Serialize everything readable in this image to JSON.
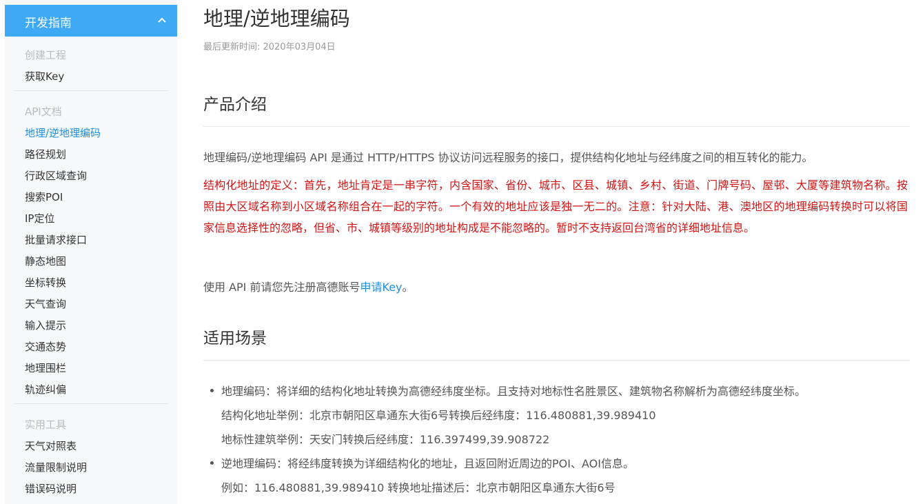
{
  "sidebar": {
    "header": "开发指南",
    "groups": [
      {
        "title": "创建工程",
        "items": [
          "获取Key"
        ]
      },
      {
        "title": "API文档",
        "items": [
          "地理/逆地理编码",
          "路径规划",
          "行政区域查询",
          "搜索POI",
          "IP定位",
          "批量请求接口",
          "静态地图",
          "坐标转换",
          "天气查询",
          "输入提示",
          "交通态势",
          "地理围栏",
          "轨迹纠偏"
        ]
      },
      {
        "title": "实用工具",
        "items": [
          "天气对照表",
          "流量限制说明",
          "错误码说明"
        ]
      }
    ]
  },
  "main": {
    "title": "地理/逆地理编码",
    "updated": "最后更新时间: 2020年03月04日",
    "sections": [
      {
        "heading": "产品介绍",
        "intro": "地理编码/逆地理编码 API 是通过 HTTP/HTTPS 协议访问远程服务的接口，提供结构化地址与经纬度之间的相互转化的能力。",
        "notice": "结构化地址的定义：首先，地址肯定是一串字符，内含国家、省份、城市、区县、城镇、乡村、街道、门牌号码、屋邨、大厦等建筑物名称。按照由大区域名称到小区域名称组合在一起的字符。一个有效的地址应该是独一无二的。注意：针对大陆、港、澳地区的地理编码转换时可以将国家信息选择性的忽略，但省、市、城镇等级别的地址构成是不能忽略的。暂时不支持返回台湾省的详细地址信息。",
        "register_prefix": "使用 API 前请您先注册高德账号",
        "register_link": "申请Key",
        "register_suffix": "。"
      },
      {
        "heading": "适用场景",
        "bullets": [
          {
            "text": "地理编码：将详细的结构化地址转换为高德经纬度坐标。且支持对地标性名胜景区、建筑物名称解析为高德经纬度坐标。",
            "sub": [
              "结构化地址举例：北京市朝阳区阜通东大街6号转换后经纬度：116.480881,39.989410",
              "地标性建筑举例：天安门转换后经纬度：116.397499,39.908722"
            ]
          },
          {
            "text": "逆地理编码：将经纬度转换为详细结构化的地址，且返回附近周边的POI、AOI信息。",
            "sub": [
              "例如：116.480881,39.989410 转换地址描述后：北京市朝阳区阜通东大街6号"
            ]
          }
        ]
      }
    ]
  }
}
